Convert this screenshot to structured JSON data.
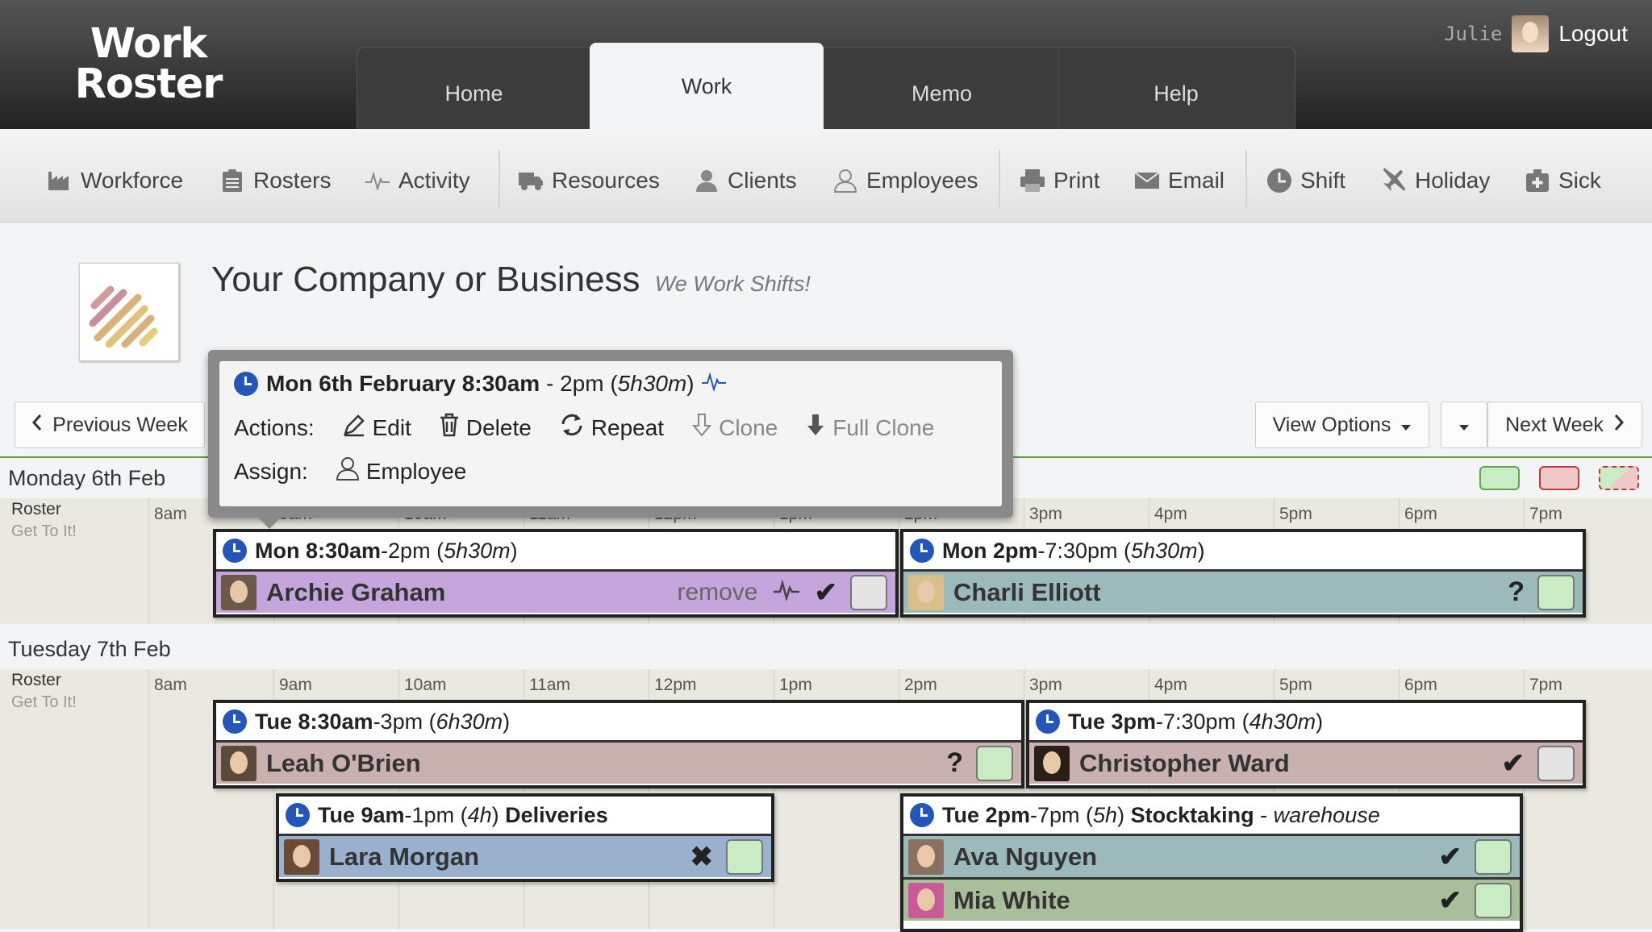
{
  "app": {
    "logo_line1": "Work",
    "logo_line2": "Roster"
  },
  "tabs": [
    {
      "label": "Home"
    },
    {
      "label": "Work"
    },
    {
      "label": "Memo"
    },
    {
      "label": "Help"
    }
  ],
  "user": {
    "name": "Julie",
    "logout": "Logout"
  },
  "toolbar": [
    {
      "label": "Workforce",
      "icon": "factory-icon"
    },
    {
      "label": "Rosters",
      "icon": "clipboard-icon"
    },
    {
      "label": "Activity",
      "icon": "pulse-icon"
    },
    {
      "label": "Resources",
      "icon": "truck-icon"
    },
    {
      "label": "Clients",
      "icon": "client-icon"
    },
    {
      "label": "Employees",
      "icon": "person-icon"
    },
    {
      "label": "Print",
      "icon": "printer-icon"
    },
    {
      "label": "Email",
      "icon": "envelope-icon"
    },
    {
      "label": "Shift",
      "icon": "clock-icon"
    },
    {
      "label": "Holiday",
      "icon": "plane-icon"
    },
    {
      "label": "Sick",
      "icon": "first-aid-icon"
    }
  ],
  "company": {
    "name": "Your Company or Business",
    "tagline": "We Work Shifts!"
  },
  "nav": {
    "prev": "Previous Week",
    "view_options": "View Options",
    "next": "Next Week"
  },
  "legend_colors": {
    "green": "#c9ecc4",
    "red": "#f0c8c8",
    "accent": "#2356b8"
  },
  "hours": [
    "8am",
    "9am",
    "10am",
    "11am",
    "12pm",
    "1pm",
    "2pm",
    "3pm",
    "4pm",
    "5pm",
    "6pm",
    "7pm"
  ],
  "days": [
    {
      "title": "Monday 6th Feb",
      "row_label": "Roster",
      "row_sub": "Get To It!"
    },
    {
      "title": "Tuesday 7th Feb",
      "row_label": "Roster",
      "row_sub": "Get To It!"
    }
  ],
  "popup": {
    "date_bold": "Mon 6th February 8:30am",
    "time_rest": "- 2pm (",
    "duration": "5h30m",
    "close_paren": ")",
    "actions_label": "Actions:",
    "edit": "Edit",
    "delete": "Delete",
    "repeat": "Repeat",
    "clone": "Clone",
    "full_clone": "Full Clone",
    "assign_label": "Assign:",
    "employee": "Employee"
  },
  "shifts": [
    {
      "bold": "Mon 8:30am",
      "rest": "-2pm (",
      "dur": "5h30m",
      "after": ")",
      "employee": "Archie Graham",
      "remove": "remove",
      "mark": "✔",
      "color": "#c4a6dd",
      "box": "#e4e4e4"
    },
    {
      "bold": "Mon 2pm",
      "rest": "-7:30pm (",
      "dur": "5h30m",
      "after": ")",
      "employee": "Charli Elliott",
      "mark": "?",
      "color": "#9bbab9",
      "box": "#c9ecc4"
    },
    {
      "bold": "Tue 8:30am",
      "rest": "-3pm (",
      "dur": "6h30m",
      "after": ")",
      "employee": "Leah O'Brien",
      "mark": "?",
      "color": "#c9b1af",
      "box": "#c9ecc4"
    },
    {
      "bold": "Tue 3pm",
      "rest": "-7:30pm (",
      "dur": "4h30m",
      "after": ")",
      "employee": "Christopher Ward",
      "mark": "✔",
      "color": "#c9b1af",
      "box": "#e4e4e4"
    },
    {
      "bold": "Tue 9am",
      "rest": "-1pm (",
      "dur": "4h",
      "after": ")",
      "extra_bold": "Deliveries",
      "employee": "Lara Morgan",
      "mark": "✖",
      "color": "#99b1cc",
      "box": "#c9ecc4"
    },
    {
      "bold": "Tue 2pm",
      "rest": "-7pm (",
      "dur": "5h",
      "after": ")",
      "extra_bold": "Stocktaking",
      "extra_rest": " - ",
      "extra_italic": "warehouse",
      "employee": "Ava Nguyen",
      "mark": "✔",
      "color": "#9bbab9",
      "box": "#c9ecc4",
      "employee2": "Mia White",
      "mark2": "✔",
      "color2": "#a9bf9c"
    }
  ]
}
